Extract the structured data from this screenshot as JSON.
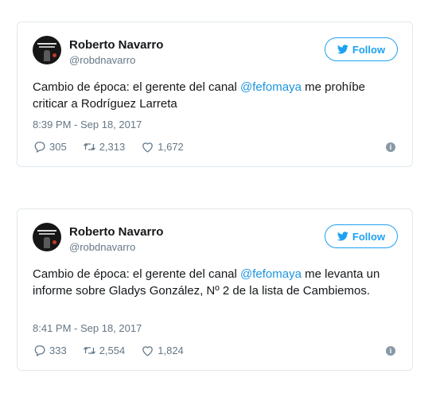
{
  "tweets": [
    {
      "name": "Roberto Navarro",
      "handle": "@robdnavarro",
      "follow_label": "Follow",
      "text_before": "Cambio de época: el gerente del canal ",
      "mention": "@fefomaya",
      "text_after": " me prohíbe criticar a Rodríguez Larreta",
      "time": "8:39 PM - Sep 18, 2017",
      "replies": "305",
      "retweets": "2,313",
      "likes": "1,672"
    },
    {
      "name": "Roberto Navarro",
      "handle": "@robdnavarro",
      "follow_label": "Follow",
      "text_before": "Cambio de época: el gerente del canal ",
      "mention": "@fefomaya",
      "text_after": " me levanta un informe sobre Gladys González, Nº 2 de la lista de Cambiemos.",
      "time": "8:41 PM - Sep 18, 2017",
      "replies": "333",
      "retweets": "2,554",
      "likes": "1,824"
    }
  ],
  "icons": {
    "twitter": "twitter-bird-icon",
    "reply": "reply-icon",
    "retweet": "retweet-icon",
    "like": "heart-icon",
    "info": "info-icon"
  },
  "colors": {
    "accent": "#1da1f2",
    "mention": "#1b95e0",
    "secondary_text": "#657786",
    "border": "#e1e8ed"
  }
}
